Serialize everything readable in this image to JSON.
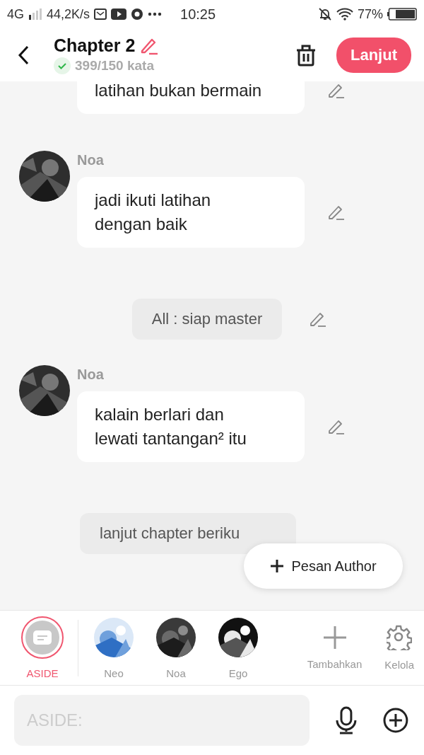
{
  "status_bar": {
    "network": "4G",
    "speed": "44,2K/s",
    "time": "10:25",
    "battery": "77%"
  },
  "header": {
    "title": "Chapter 2",
    "word_count": "399/150 kata",
    "next_button": "Lanjut"
  },
  "messages": [
    {
      "kind": "character",
      "text": "latihan bukan bermain"
    },
    {
      "kind": "character",
      "speaker": "Noa",
      "text": "jadi ikuti latihan\ndengan baik"
    },
    {
      "kind": "aside",
      "text": "All : siap master"
    },
    {
      "kind": "character",
      "speaker": "Noa",
      "text": "kalain berlari dan\nlewati tantangan² itu"
    },
    {
      "kind": "aside",
      "text": "lanjut chapter beriku"
    }
  ],
  "floating_button": "Pesan Author",
  "characters": [
    {
      "kind": "aside",
      "name": "ASIDE",
      "selected": true
    },
    {
      "kind": "avatar",
      "name": "Neo",
      "selected": false
    },
    {
      "kind": "avatar",
      "name": "Noa",
      "selected": false
    },
    {
      "kind": "avatar",
      "name": "Ego",
      "selected": false
    }
  ],
  "actions": [
    {
      "kind": "add",
      "label": "Tambahkan"
    },
    {
      "kind": "manage",
      "label": "Kelola"
    }
  ],
  "composer": {
    "placeholder": "ASIDE:"
  }
}
